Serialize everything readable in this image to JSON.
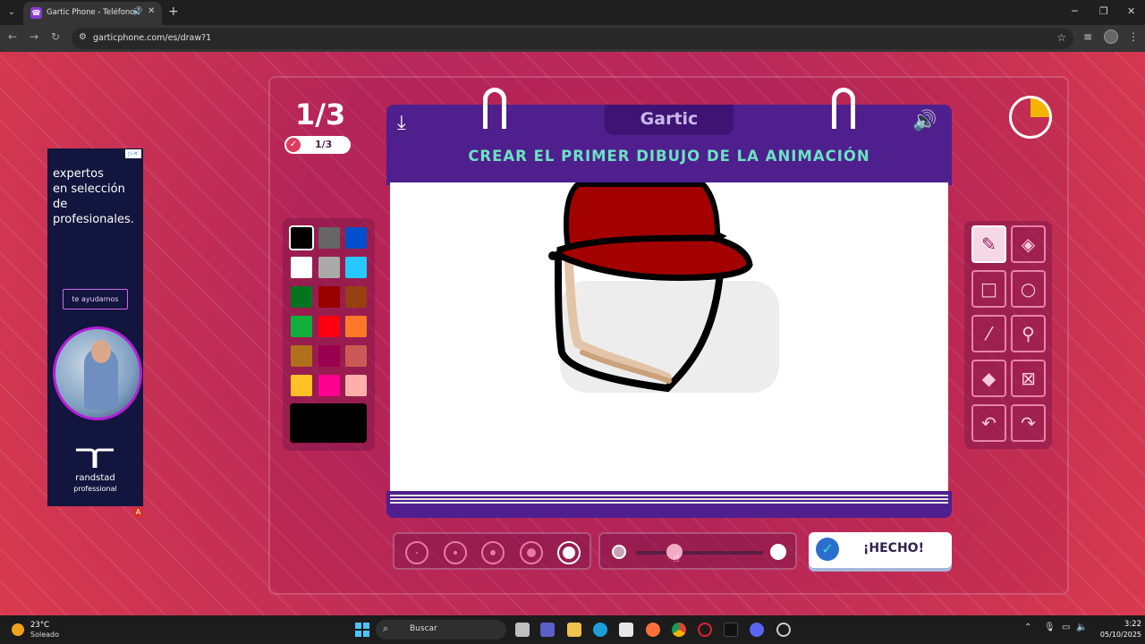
{
  "browser": {
    "tab_title": "Gartic Phone - Teléfono De",
    "url": "garticphone.com/es/draw?1"
  },
  "ad": {
    "headline_lines": [
      "expertos",
      "en selección",
      "de",
      "profesionales."
    ],
    "cta": "te ayudamos",
    "brand": "randstad",
    "brand_sub": "professional"
  },
  "game": {
    "round_counter": "1/3",
    "round_badge": "1/3",
    "logo": "Gartic",
    "instruction": "CREAR EL PRIMER DIBUJO DE LA ANIMACIÓN",
    "timer_fraction_elapsed": 0.25,
    "palette": [
      "#000000",
      "#666666",
      "#0050cd",
      "#ffffff",
      "#aaaaaa",
      "#26c9ff",
      "#017420",
      "#990000",
      "#964112",
      "#11b03c",
      "#ff0013",
      "#ff7829",
      "#b0701c",
      "#99004e",
      "#cb5a57",
      "#ffc126",
      "#ff008f",
      "#feafa8"
    ],
    "current_color": "#000000",
    "tools": [
      "pencil-icon",
      "eraser-icon",
      "rectangle-icon",
      "ellipse-icon",
      "line-icon",
      "eyedropper-icon",
      "fill-icon",
      "clear-icon",
      "undo-icon",
      "redo-icon"
    ],
    "brush_sizes": 5,
    "active_brush_size": 5,
    "opacity_fraction": 0.3,
    "done_label": "¡HECHO!"
  },
  "taskbar": {
    "weather_temp": "23°C",
    "weather_desc": "Soleado",
    "search_placeholder": "Buscar",
    "time": "3:22",
    "date": "05/10/2025"
  },
  "colors": {
    "header_purple": "#4f1f8e",
    "instruction_teal": "#6ae3c2",
    "background_red": "#d83a4e"
  }
}
